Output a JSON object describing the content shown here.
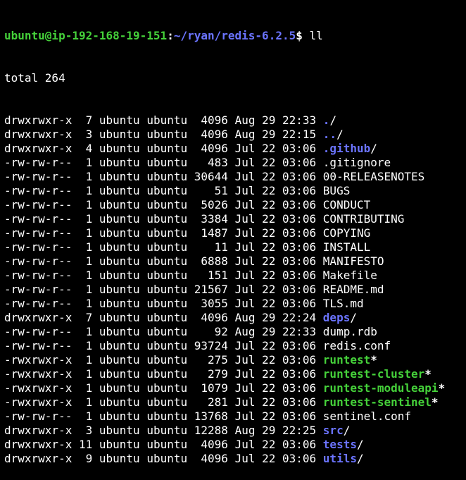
{
  "colors": {
    "background": "#000000",
    "text": "#ffffff",
    "user_host": "#45d13a",
    "path": "#6b74ff",
    "directory": "#6b74ff",
    "executable": "#45d13a"
  },
  "prompt": {
    "user_host": "ubuntu@ip-192-168-19-151",
    "separator": ":",
    "path": "~/ryan/redis-6.2.5",
    "symbol": "$ ",
    "command": "ll"
  },
  "total_line": "total 264",
  "entries": [
    {
      "perms": "drwxrwxr-x",
      "links": " 7",
      "owner": "ubuntu",
      "group": "ubuntu",
      "size": " 4096",
      "date": "Aug 29 22:33",
      "name": ".",
      "kind": "dir",
      "suffix": "/"
    },
    {
      "perms": "drwxrwxr-x",
      "links": " 3",
      "owner": "ubuntu",
      "group": "ubuntu",
      "size": " 4096",
      "date": "Aug 29 22:15",
      "name": "..",
      "kind": "dir",
      "suffix": "/"
    },
    {
      "perms": "drwxrwxr-x",
      "links": " 4",
      "owner": "ubuntu",
      "group": "ubuntu",
      "size": " 4096",
      "date": "Jul 22 03:06",
      "name": ".github",
      "kind": "dir",
      "suffix": "/"
    },
    {
      "perms": "-rw-rw-r--",
      "links": " 1",
      "owner": "ubuntu",
      "group": "ubuntu",
      "size": "  483",
      "date": "Jul 22 03:06",
      "name": ".gitignore",
      "kind": "file",
      "suffix": ""
    },
    {
      "perms": "-rw-rw-r--",
      "links": " 1",
      "owner": "ubuntu",
      "group": "ubuntu",
      "size": "30644",
      "date": "Jul 22 03:06",
      "name": "00-RELEASENOTES",
      "kind": "file",
      "suffix": ""
    },
    {
      "perms": "-rw-rw-r--",
      "links": " 1",
      "owner": "ubuntu",
      "group": "ubuntu",
      "size": "   51",
      "date": "Jul 22 03:06",
      "name": "BUGS",
      "kind": "file",
      "suffix": ""
    },
    {
      "perms": "-rw-rw-r--",
      "links": " 1",
      "owner": "ubuntu",
      "group": "ubuntu",
      "size": " 5026",
      "date": "Jul 22 03:06",
      "name": "CONDUCT",
      "kind": "file",
      "suffix": ""
    },
    {
      "perms": "-rw-rw-r--",
      "links": " 1",
      "owner": "ubuntu",
      "group": "ubuntu",
      "size": " 3384",
      "date": "Jul 22 03:06",
      "name": "CONTRIBUTING",
      "kind": "file",
      "suffix": ""
    },
    {
      "perms": "-rw-rw-r--",
      "links": " 1",
      "owner": "ubuntu",
      "group": "ubuntu",
      "size": " 1487",
      "date": "Jul 22 03:06",
      "name": "COPYING",
      "kind": "file",
      "suffix": ""
    },
    {
      "perms": "-rw-rw-r--",
      "links": " 1",
      "owner": "ubuntu",
      "group": "ubuntu",
      "size": "   11",
      "date": "Jul 22 03:06",
      "name": "INSTALL",
      "kind": "file",
      "suffix": ""
    },
    {
      "perms": "-rw-rw-r--",
      "links": " 1",
      "owner": "ubuntu",
      "group": "ubuntu",
      "size": " 6888",
      "date": "Jul 22 03:06",
      "name": "MANIFESTO",
      "kind": "file",
      "suffix": ""
    },
    {
      "perms": "-rw-rw-r--",
      "links": " 1",
      "owner": "ubuntu",
      "group": "ubuntu",
      "size": "  151",
      "date": "Jul 22 03:06",
      "name": "Makefile",
      "kind": "file",
      "suffix": ""
    },
    {
      "perms": "-rw-rw-r--",
      "links": " 1",
      "owner": "ubuntu",
      "group": "ubuntu",
      "size": "21567",
      "date": "Jul 22 03:06",
      "name": "README.md",
      "kind": "file",
      "suffix": ""
    },
    {
      "perms": "-rw-rw-r--",
      "links": " 1",
      "owner": "ubuntu",
      "group": "ubuntu",
      "size": " 3055",
      "date": "Jul 22 03:06",
      "name": "TLS.md",
      "kind": "file",
      "suffix": ""
    },
    {
      "perms": "drwxrwxr-x",
      "links": " 7",
      "owner": "ubuntu",
      "group": "ubuntu",
      "size": " 4096",
      "date": "Aug 29 22:24",
      "name": "deps",
      "kind": "dir",
      "suffix": "/"
    },
    {
      "perms": "-rw-rw-r--",
      "links": " 1",
      "owner": "ubuntu",
      "group": "ubuntu",
      "size": "   92",
      "date": "Aug 29 22:33",
      "name": "dump.rdb",
      "kind": "file",
      "suffix": ""
    },
    {
      "perms": "-rw-rw-r--",
      "links": " 1",
      "owner": "ubuntu",
      "group": "ubuntu",
      "size": "93724",
      "date": "Jul 22 03:06",
      "name": "redis.conf",
      "kind": "file",
      "suffix": ""
    },
    {
      "perms": "-rwxrwxr-x",
      "links": " 1",
      "owner": "ubuntu",
      "group": "ubuntu",
      "size": "  275",
      "date": "Jul 22 03:06",
      "name": "runtest",
      "kind": "exec",
      "suffix": "*"
    },
    {
      "perms": "-rwxrwxr-x",
      "links": " 1",
      "owner": "ubuntu",
      "group": "ubuntu",
      "size": "  279",
      "date": "Jul 22 03:06",
      "name": "runtest-cluster",
      "kind": "exec",
      "suffix": "*"
    },
    {
      "perms": "-rwxrwxr-x",
      "links": " 1",
      "owner": "ubuntu",
      "group": "ubuntu",
      "size": " 1079",
      "date": "Jul 22 03:06",
      "name": "runtest-moduleapi",
      "kind": "exec",
      "suffix": "*"
    },
    {
      "perms": "-rwxrwxr-x",
      "links": " 1",
      "owner": "ubuntu",
      "group": "ubuntu",
      "size": "  281",
      "date": "Jul 22 03:06",
      "name": "runtest-sentinel",
      "kind": "exec",
      "suffix": "*"
    },
    {
      "perms": "-rw-rw-r--",
      "links": " 1",
      "owner": "ubuntu",
      "group": "ubuntu",
      "size": "13768",
      "date": "Jul 22 03:06",
      "name": "sentinel.conf",
      "kind": "file",
      "suffix": ""
    },
    {
      "perms": "drwxrwxr-x",
      "links": " 3",
      "owner": "ubuntu",
      "group": "ubuntu",
      "size": "12288",
      "date": "Aug 29 22:25",
      "name": "src",
      "kind": "dir",
      "suffix": "/"
    },
    {
      "perms": "drwxrwxr-x",
      "links": "11",
      "owner": "ubuntu",
      "group": "ubuntu",
      "size": " 4096",
      "date": "Jul 22 03:06",
      "name": "tests",
      "kind": "dir",
      "suffix": "/"
    },
    {
      "perms": "drwxrwxr-x",
      "links": " 9",
      "owner": "ubuntu",
      "group": "ubuntu",
      "size": " 4096",
      "date": "Jul 22 03:06",
      "name": "utils",
      "kind": "dir",
      "suffix": "/"
    }
  ]
}
